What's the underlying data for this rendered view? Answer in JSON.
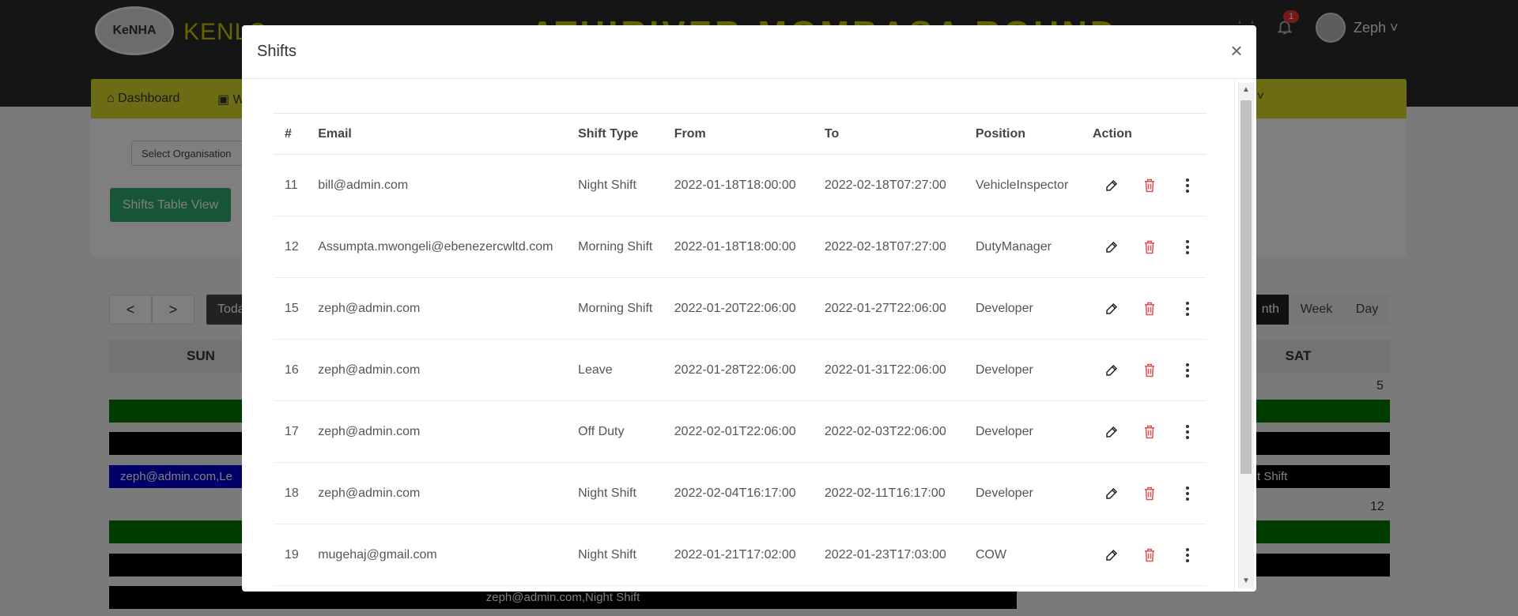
{
  "background": {
    "brand": {
      "logo_text": "KeNHA",
      "name": "KENLO"
    },
    "banner": "ATHIRIVER-MOMBASA ROUND",
    "notifications": {
      "count": "1"
    },
    "user": {
      "name": "Zeph ˅"
    },
    "nav": {
      "dashboard": "Dashboard",
      "second": "W"
    },
    "filters": {
      "organisation_placeholder": "Select Organisation"
    },
    "shifts_table_view_label": "Shifts Table View",
    "calendar": {
      "prev": "<",
      "next": ">",
      "today": "Toda",
      "views": {
        "month": "nth",
        "week": "Week",
        "day": "Day"
      },
      "headers": {
        "sun": "SUN",
        "sat": "SAT"
      },
      "day_numbers": {
        "sat_first": "5",
        "sat_second": "12"
      },
      "events": {
        "sun_blue": "zeph@admin.com,Le",
        "sat_black": "t Shift",
        "bottom_black": "zeph@admin.com,Night Shift"
      }
    }
  },
  "modal": {
    "title": "Shifts",
    "close": "×",
    "columns": [
      "#",
      "Email",
      "Shift Type",
      "From",
      "To",
      "Position",
      "Action"
    ],
    "rows": [
      {
        "id": "11",
        "email": "bill@admin.com",
        "shift_type": "Night Shift",
        "from": "2022-01-18T18:00:00",
        "to": "2022-02-18T07:27:00",
        "position": "VehicleInspector"
      },
      {
        "id": "12",
        "email": "Assumpta.mwongeli@ebenezercwltd.com",
        "shift_type": "Morning Shift",
        "from": "2022-01-18T18:00:00",
        "to": "2022-02-18T07:27:00",
        "position": "DutyManager"
      },
      {
        "id": "15",
        "email": "zeph@admin.com",
        "shift_type": "Morning Shift",
        "from": "2022-01-20T22:06:00",
        "to": "2022-01-27T22:06:00",
        "position": "Developer"
      },
      {
        "id": "16",
        "email": "zeph@admin.com",
        "shift_type": "Leave",
        "from": "2022-01-28T22:06:00",
        "to": "2022-01-31T22:06:00",
        "position": "Developer"
      },
      {
        "id": "17",
        "email": "zeph@admin.com",
        "shift_type": "Off Duty",
        "from": "2022-02-01T22:06:00",
        "to": "2022-02-03T22:06:00",
        "position": "Developer"
      },
      {
        "id": "18",
        "email": "zeph@admin.com",
        "shift_type": "Night Shift",
        "from": "2022-02-04T16:17:00",
        "to": "2022-02-11T16:17:00",
        "position": "Developer"
      },
      {
        "id": "19",
        "email": "mugehaj@gmail.com",
        "shift_type": "Night Shift",
        "from": "2022-01-21T17:02:00",
        "to": "2022-01-23T17:03:00",
        "position": "COW"
      }
    ],
    "action_icons": [
      "pencil-icon",
      "trash-icon",
      "kebab-menu-icon"
    ],
    "colors": {
      "trash": "#e05050",
      "overlay": "rgba(0,0,0,0.5)"
    }
  }
}
